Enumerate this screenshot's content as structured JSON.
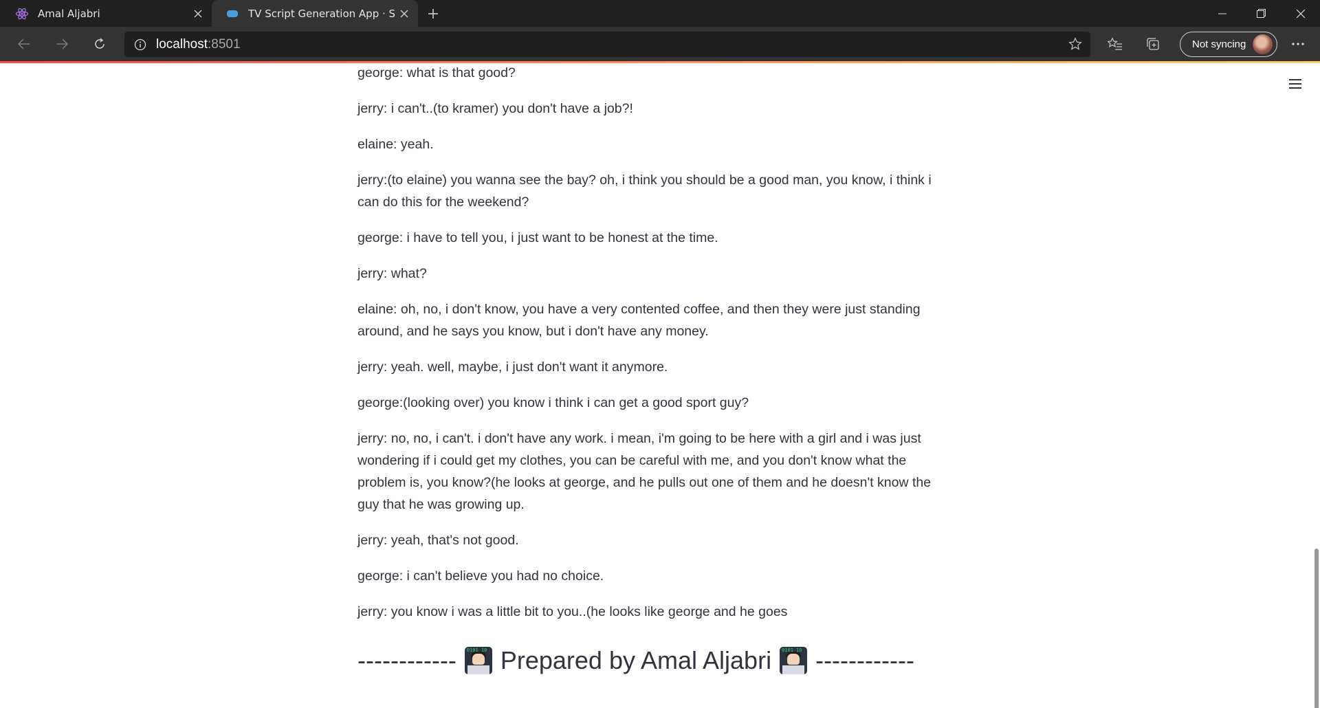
{
  "browser": {
    "tabs": [
      {
        "title": "Amal Aljabri",
        "icon": "atom-icon",
        "active": false
      },
      {
        "title": "TV Script Generation App · Streamlit",
        "icon": "streamlit-icon",
        "active": true
      }
    ],
    "address": {
      "host": "localhost",
      "port": ":8501"
    },
    "sync_label": "Not syncing"
  },
  "script": {
    "lines": [
      "george: what is that good?",
      "jerry: i can't..(to kramer) you don't have a job?!",
      "elaine: yeah.",
      "jerry:(to elaine) you wanna see the bay? oh, i think you should be a good man, you know, i think i can do this for the weekend?",
      "george: i have to tell you, i just want to be honest at the time.",
      "jerry: what?",
      "elaine: oh, no, i don't know, you have a very contented coffee, and then they were just standing around, and he says you know, but i don't have any money.",
      "jerry: yeah. well, maybe, i just don't want it anymore.",
      "george:(looking over) you know i think i can get a good sport guy?",
      "jerry: no, no, i can't. i don't have any work. i mean, i'm going to be here with a girl and i was just wondering if i could get my clothes, you can be careful with me, and you don't know what the problem is, you know?(he looks at george, and he pulls out one of them and he doesn't know the guy that he was growing up.",
      "jerry: yeah, that's not good.",
      "george: i can't believe you had no choice.",
      "jerry: you know i was a little bit to you..(he looks like george and he goes"
    ]
  },
  "footer": {
    "dashes_left": "------------",
    "text": "Prepared by Amal Aljabri",
    "dashes_right": "------------",
    "emoji": "technologist-emoji"
  }
}
